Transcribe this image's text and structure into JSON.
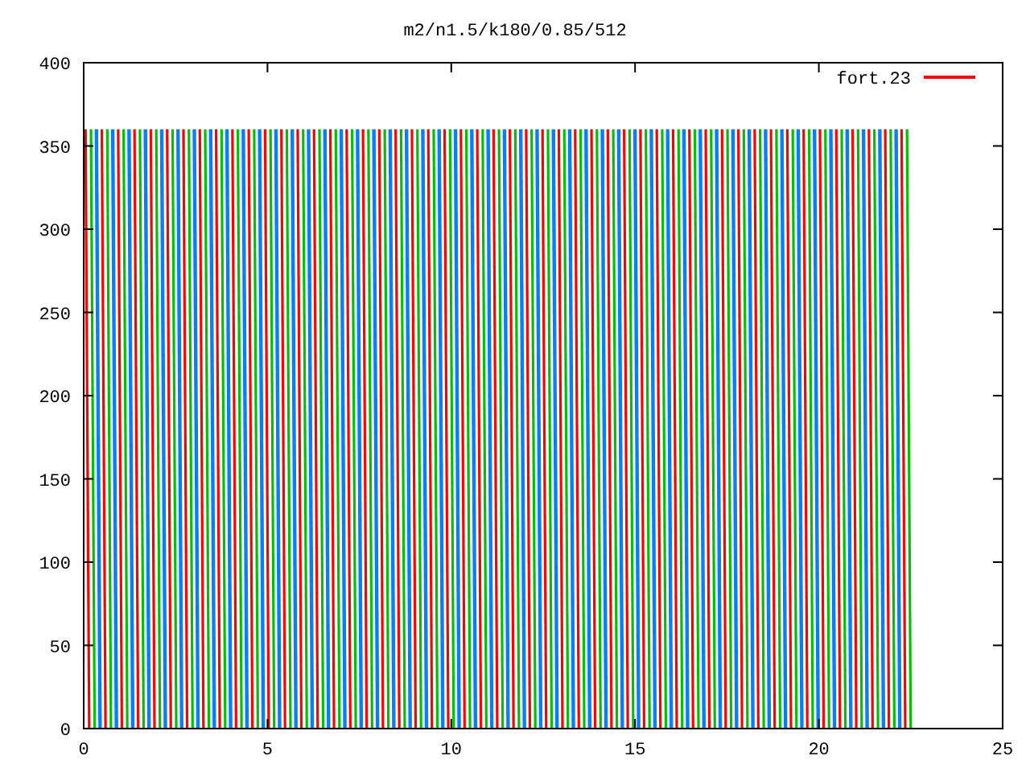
{
  "plot": {
    "title": "m2/n1.5/k180/0.85/512",
    "yticks": [
      "400",
      "350",
      "300",
      "250",
      "200",
      "150",
      "100",
      "50",
      "0"
    ],
    "xticks": [
      "0",
      "5",
      "10",
      "15",
      "20",
      "25"
    ],
    "legend": {
      "label": "fort.23",
      "color": "#ff0000"
    }
  }
}
